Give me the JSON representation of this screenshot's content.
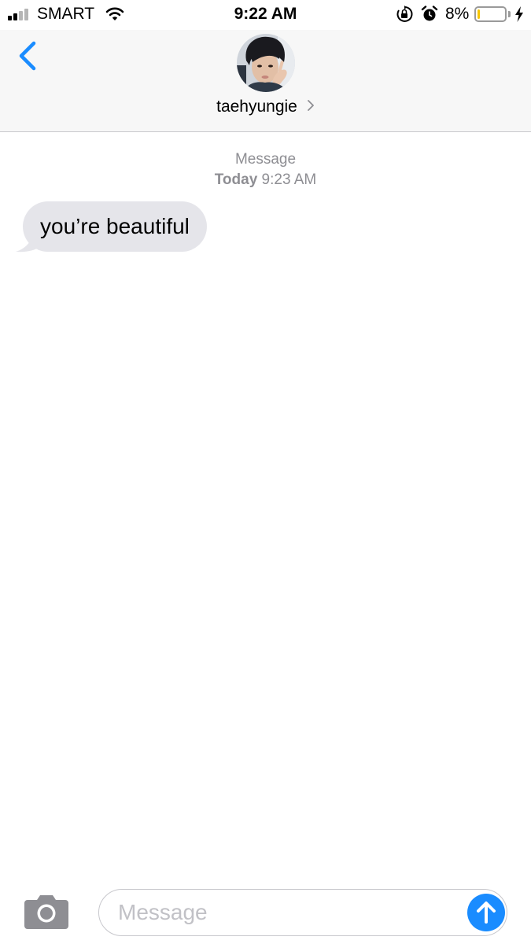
{
  "status_bar": {
    "carrier": "SMART",
    "time": "9:22 AM",
    "battery_percent": "8%",
    "battery_level": 0.08,
    "icons": [
      "signal-icon",
      "wifi-icon",
      "orientation-lock-icon",
      "alarm-icon",
      "battery-icon",
      "charging-bolt-icon"
    ]
  },
  "header": {
    "back_icon": "chevron-left-icon",
    "contact_name": "taehyungie",
    "detail_icon": "chevron-right-icon"
  },
  "conversation": {
    "service_label": "Message",
    "day_label": "Today",
    "time_label": "9:23 AM",
    "messages": [
      {
        "direction": "received",
        "text": "you’re beautiful"
      }
    ]
  },
  "composer": {
    "camera_icon": "camera-icon",
    "placeholder": "Message",
    "value": "",
    "send_icon": "arrow-up-icon"
  },
  "colors": {
    "accent": "#1a8cff",
    "received_bubble": "#e5e5ea",
    "timestamp_gray": "#8e8e93",
    "header_bg": "#f7f7f7",
    "battery_low": "#f7c600"
  }
}
